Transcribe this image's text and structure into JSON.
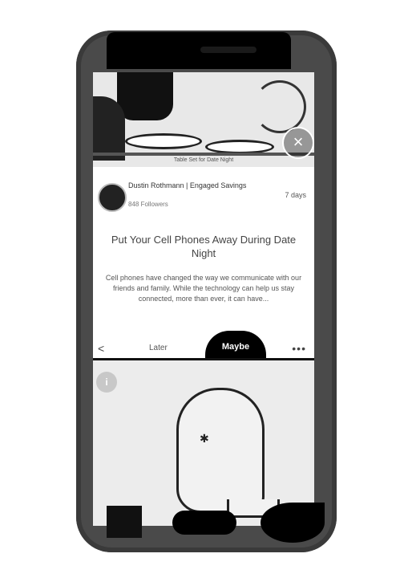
{
  "article": {
    "hero_caption": "Table Set for Date Night",
    "close_symbol": "×",
    "author_name": "Dustin Rothmann | Engaged Savings",
    "author_meta": "848 Followers",
    "time": "7 days",
    "title": "Put Your Cell Phones Away During Date Night",
    "excerpt": "Cell phones have changed the way we communicate with our friends and family. While the technology can help us stay connected, more than ever, it can have..."
  },
  "actions": {
    "later_label": "Later",
    "notnow_label": "Maybe",
    "more_label": "•••"
  },
  "lower_card": {
    "badge": "i"
  },
  "icons": {
    "share": "share-icon",
    "close": "close-icon",
    "more": "more-icon"
  }
}
